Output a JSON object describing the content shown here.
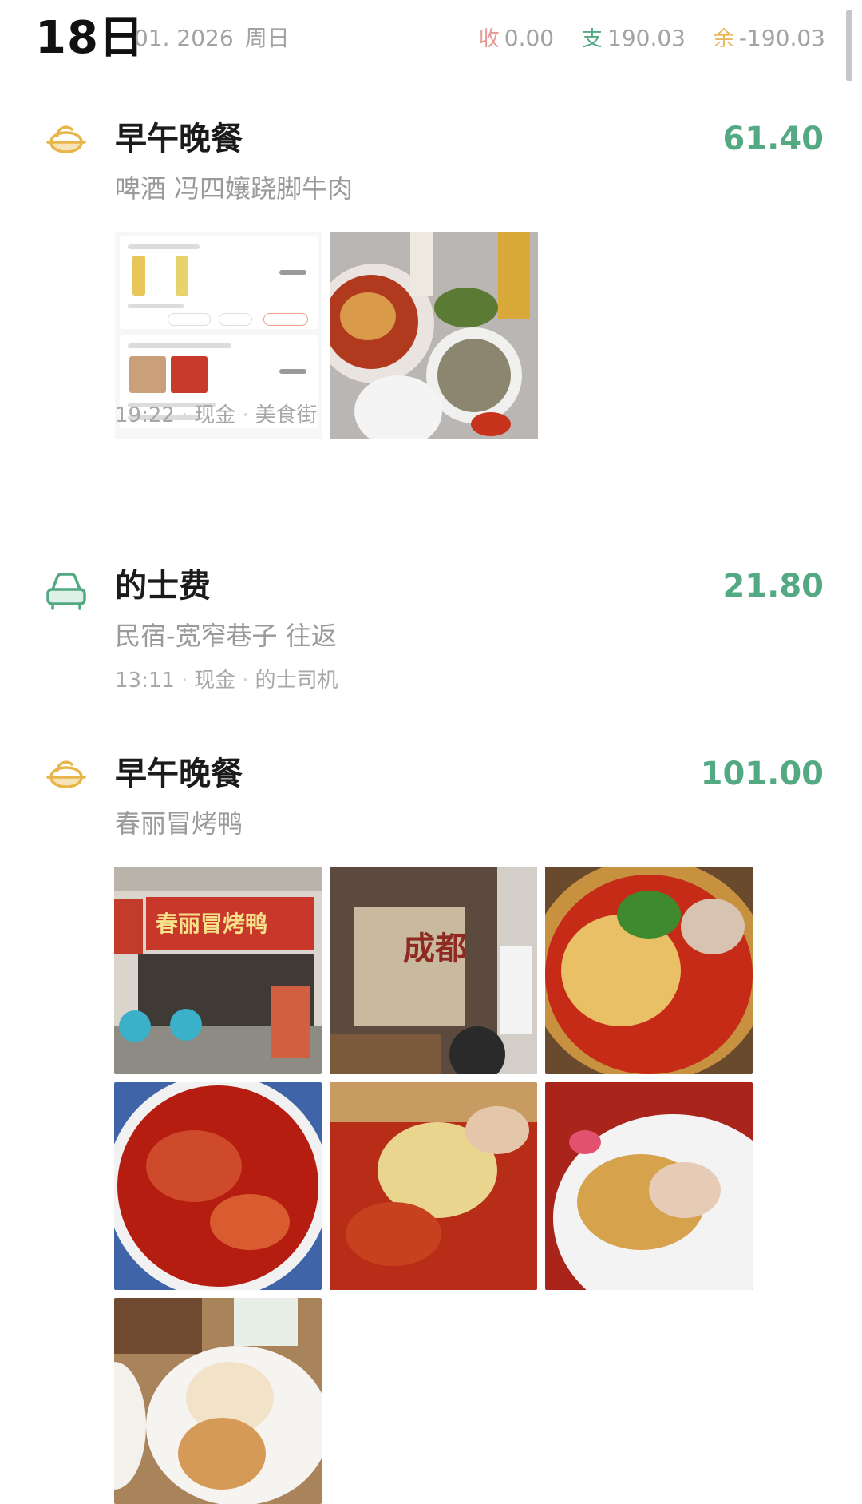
{
  "header": {
    "day": "18日",
    "date": "01. 2026",
    "weekday": "周日",
    "income_tag": "收",
    "income": "0.00",
    "expense_tag": "支",
    "expense": "190.03",
    "balance_tag": "余",
    "balance": "-190.03"
  },
  "colors": {
    "income": "#e59a93",
    "expense": "#52a982",
    "balance": "#e7b85a",
    "amount": "#52a982",
    "meal_icon": "#e7b54a",
    "taxi_icon": "#52a982"
  },
  "entries": [
    {
      "icon": "bowl-icon",
      "title": "早午晚餐",
      "amount": "61.40",
      "note": "啤酒 冯四孃跷脚牛肉",
      "time": "19:22",
      "account": "现金",
      "merchant": "美食街",
      "photos": 2
    },
    {
      "icon": "car-icon",
      "title": "的士费",
      "amount": "21.80",
      "note": "民宿-宽窄巷子 往返",
      "time": "13:11",
      "account": "现金",
      "merchant": "的士司机",
      "photos": 0
    },
    {
      "icon": "bowl-icon",
      "title": "早午晚餐",
      "amount": "101.00",
      "note": "春丽冒烤鸭",
      "photos": 7
    }
  ]
}
